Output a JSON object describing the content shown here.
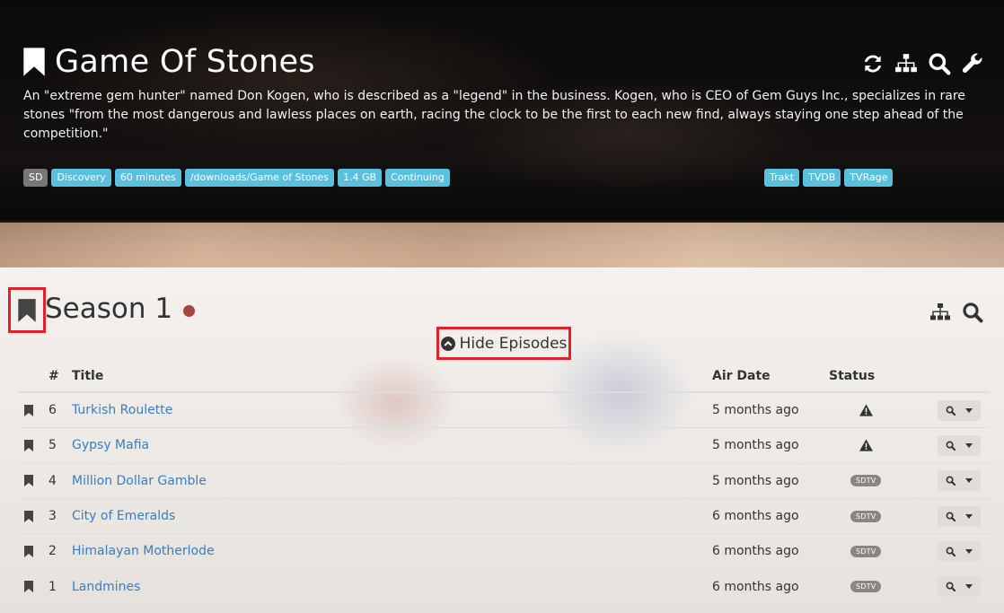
{
  "show": {
    "title": "Game Of Stones",
    "description": "An \"extreme gem hunter\" named Don Kogen, who is described as a \"legend\" in the business. Kogen, who is CEO of Gem Guys Inc., specializes in rare stones \"from the most dangerous and lawless places on earth, racing the clock to be the first to each new find, always staying one step ahead of the competition.\"",
    "tags": [
      "SD",
      "Discovery",
      "60 minutes",
      "/downloads/Game of Stones",
      "1.4 GB",
      "Continuing"
    ],
    "links": [
      "Trakt",
      "TVDB",
      "TVRage"
    ],
    "tool_icons": [
      "refresh-icon",
      "organize-icon",
      "search-icon",
      "wrench-icon"
    ]
  },
  "season": {
    "title": "Season 1",
    "toggle_label": "Hide Episodes",
    "tool_icons": [
      "organize-icon",
      "search-icon"
    ]
  },
  "table": {
    "headers": {
      "number": "#",
      "title": "Title",
      "air_date": "Air Date",
      "status": "Status"
    },
    "episodes": [
      {
        "number": "6",
        "title": "Turkish Roulette",
        "air_date": "5 months ago",
        "status": "warning"
      },
      {
        "number": "5",
        "title": "Gypsy Mafia",
        "air_date": "5 months ago",
        "status": "warning"
      },
      {
        "number": "4",
        "title": "Million Dollar Gamble",
        "air_date": "5 months ago",
        "status": "SDTV"
      },
      {
        "number": "3",
        "title": "City of Emeralds",
        "air_date": "6 months ago",
        "status": "SDTV"
      },
      {
        "number": "2",
        "title": "Himalayan Motherlode",
        "air_date": "6 months ago",
        "status": "SDTV"
      },
      {
        "number": "1",
        "title": "Landmines",
        "air_date": "6 months ago",
        "status": "SDTV"
      }
    ]
  },
  "colors": {
    "tag_blue": "#5bc0de",
    "tag_grey": "#777777",
    "link_blue": "#3a7ec0",
    "season_dot": "#a9433d",
    "highlight_red": "#e3202a"
  }
}
